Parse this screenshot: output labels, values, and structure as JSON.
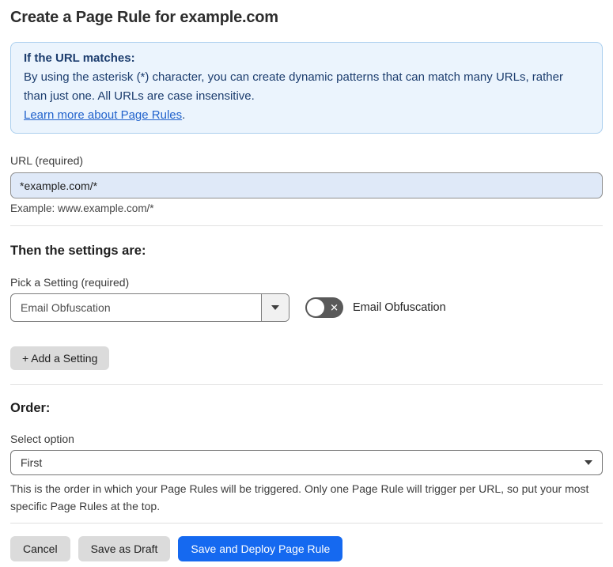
{
  "page": {
    "title": "Create a Page Rule for example.com"
  },
  "info_box": {
    "heading": "If the URL matches:",
    "body": "By using the asterisk (*) character, you can create dynamic patterns that can match many URLs, rather than just one. All URLs are case insensitive.",
    "link_label": "Learn more about Page Rules",
    "link_suffix": "."
  },
  "url_field": {
    "label": "URL (required)",
    "value": "*example.com/*",
    "helper": "Example: www.example.com/*"
  },
  "settings_section": {
    "heading": "Then the settings are:",
    "picker_label": "Pick a Setting (required)",
    "selected_setting": "Email Obfuscation",
    "toggle": {
      "state": "off",
      "label": "Email Obfuscation"
    },
    "add_setting_label": "+ Add a Setting"
  },
  "order_section": {
    "heading": "Order:",
    "select_label": "Select option",
    "selected_option": "First",
    "helper": "This is the order in which your Page Rules will be triggered. Only one Page Rule will trigger per URL, so put your most specific Page Rules at the top."
  },
  "footer": {
    "cancel_label": "Cancel",
    "save_draft_label": "Save as Draft",
    "save_deploy_label": "Save and Deploy Page Rule"
  },
  "icons": {
    "x_glyph": "✕"
  },
  "colors": {
    "accent_blue": "#1569f0",
    "info_bg": "#ebf4fd",
    "info_border": "#abcfee",
    "info_text": "#1c3d6e",
    "link": "#2263cc",
    "input_bg": "#dfe9f8",
    "toggle_off": "#595959",
    "btn_gray": "#dbdbdb",
    "divider": "#e0e0e0"
  }
}
